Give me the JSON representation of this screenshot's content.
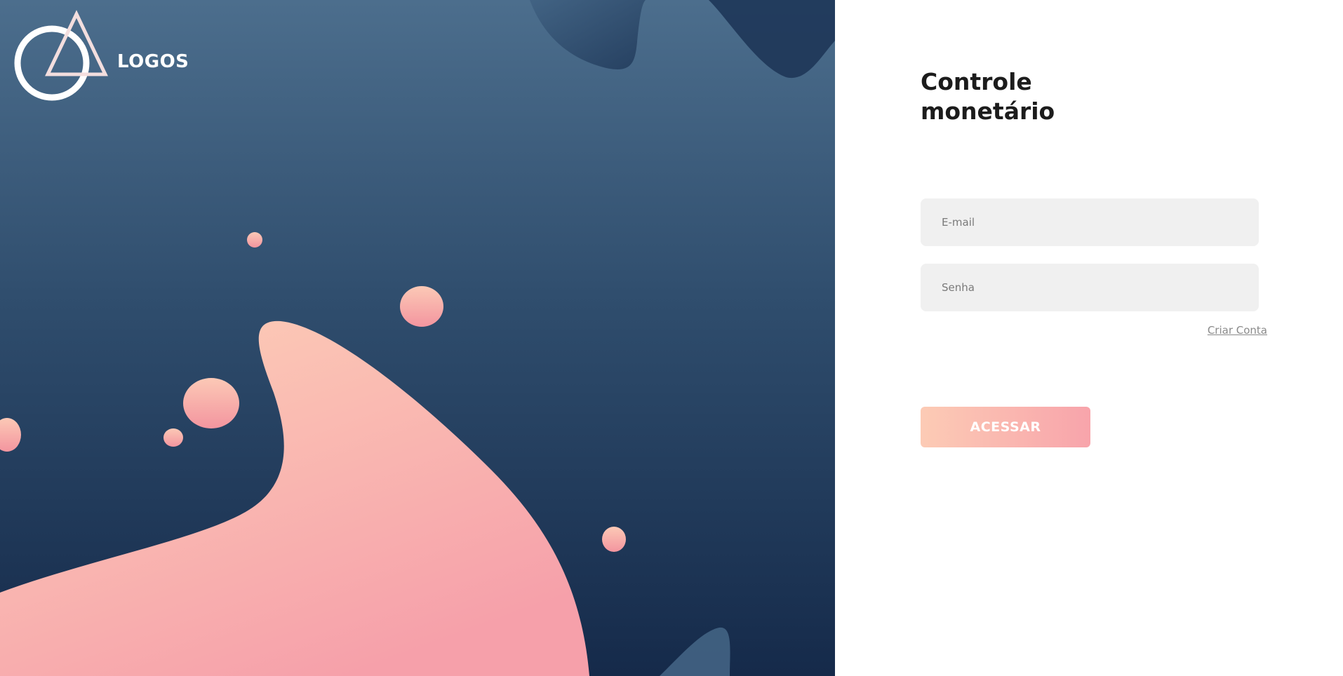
{
  "brand": {
    "name": "LOGOS",
    "icon": "circle-triangle-logo-icon"
  },
  "form": {
    "title_line1": "Controle",
    "title_line2": "monetário",
    "email_placeholder": "E-mail",
    "password_placeholder": "Senha",
    "create_account_link": "Criar Conta",
    "submit_label": "ACESSAR"
  },
  "colors": {
    "hero_top": "#4c6e8d",
    "hero_bottom": "#152a4a",
    "accent_start": "#fccbb5",
    "accent_end": "#f8a4ab",
    "input_bg": "#f0f0f0",
    "title": "#1c1c1c"
  }
}
